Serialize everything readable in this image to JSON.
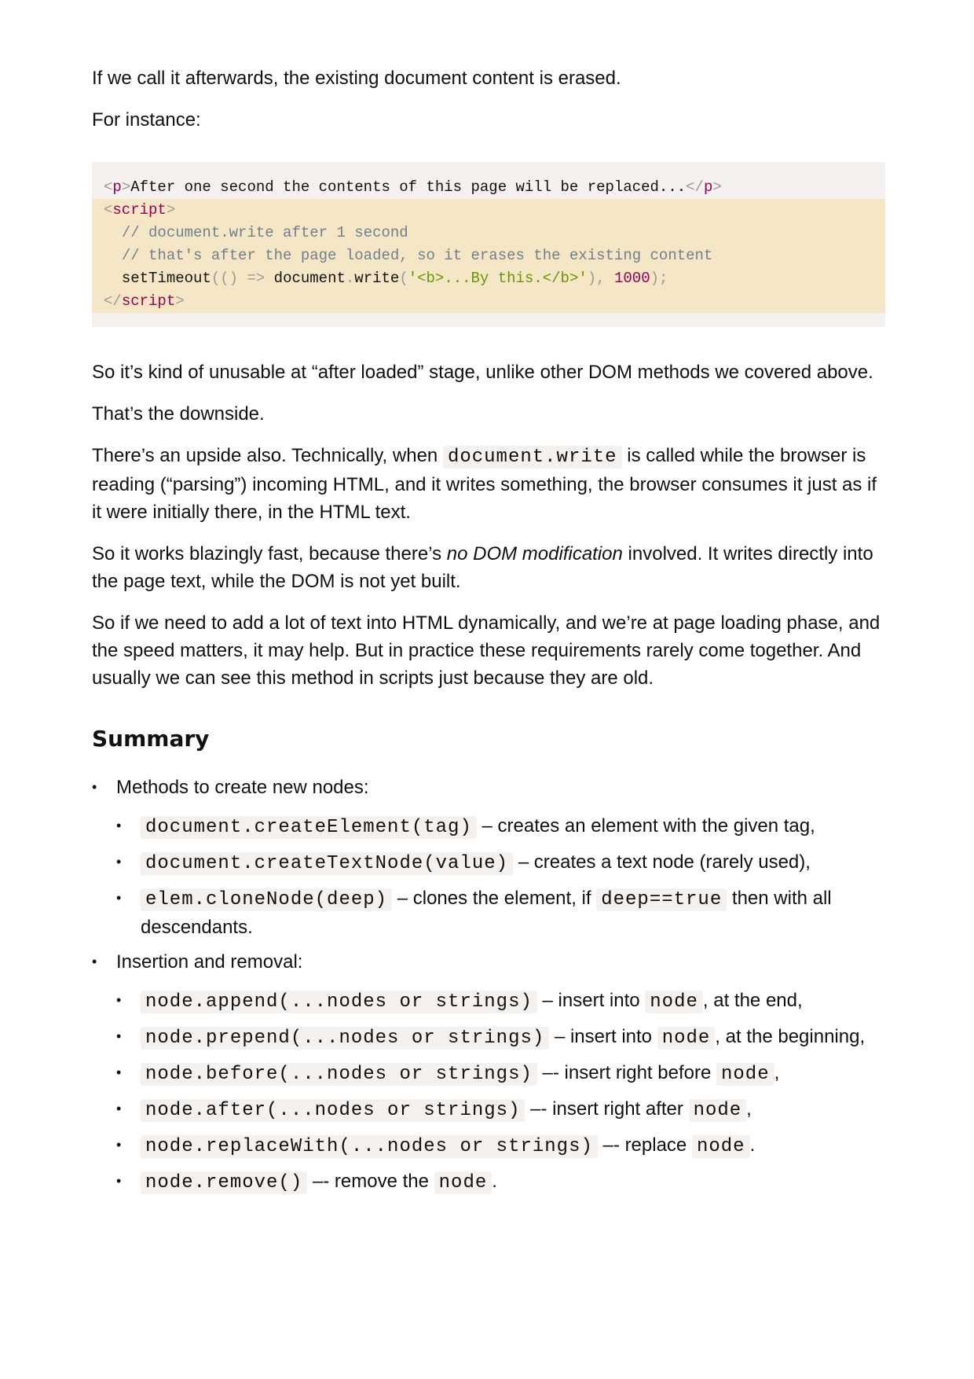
{
  "p1": "If we call it afterwards, the existing document content is erased.",
  "p2": "For instance:",
  "code": {
    "l1_text": "After one second the contents of this page will be replaced...",
    "l1_tag": "p",
    "l2_tag": "script",
    "l3_comment": "// document.write after 1 second",
    "l4_comment": "// that's after the page loaded, so it erases the existing content",
    "l5_fn": "setTimeout",
    "l5_obj": "document",
    "l5_method": "write",
    "l5_str": "'<b>...By this.</b>'",
    "l5_num": "1000",
    "l6_tag": "script"
  },
  "p3": "So it’s kind of unusable at “after loaded” stage, unlike other DOM methods we covered above.",
  "p4": "That’s the downside.",
  "p5": {
    "a": "There’s an upside also. Technically, when ",
    "code": "document.write",
    "b": " is called while the browser is reading (“parsing”) incoming HTML, and it writes something, the browser consumes it just as if it were initially there, in the HTML text."
  },
  "p6": {
    "a": "So it works blazingly fast, because there’s ",
    "em": "no DOM modification",
    "b": " involved. It writes directly into the page text, while the DOM is not yet built."
  },
  "p7": "So if we need to add a lot of text into HTML dynamically, and we’re at page loading phase, and the speed matters, it may help. But in practice these requirements rarely come together. And usually we can see this method in scripts just because they are old.",
  "summary_title": "Summary",
  "create": {
    "label": "Methods to create new nodes:",
    "i1_code": "document.createElement(tag)",
    "i1_text": " – creates an element with the given tag,",
    "i2_code": "document.createTextNode(value)",
    "i2_text": " – creates a text node (rarely used),",
    "i3_code": "elem.cloneNode(deep)",
    "i3_text_a": " – clones the element, if ",
    "i3_code2": "deep==true",
    "i3_text_b": " then with all descendants."
  },
  "insert": {
    "label": "Insertion and removal:",
    "i1_code": "node.append(...nodes or strings)",
    "i1_a": " – insert into ",
    "i1_node": "node",
    "i1_b": ", at the end,",
    "i2_code": "node.prepend(...nodes or strings)",
    "i2_a": " – insert into ",
    "i2_node": "node",
    "i2_b": ", at the beginning,",
    "i3_code": "node.before(...nodes or strings)",
    "i3_a": " –- insert right before ",
    "i3_node": "node",
    "i3_b": ",",
    "i4_code": "node.after(...nodes or strings)",
    "i4_a": " –- insert right after ",
    "i4_node": "node",
    "i4_b": ",",
    "i5_code": "node.replaceWith(...nodes or strings)",
    "i5_a": " –- replace ",
    "i5_node": "node",
    "i5_b": ".",
    "i6_code": "node.remove()",
    "i6_a": " –- remove the ",
    "i6_node": "node",
    "i6_b": "."
  }
}
